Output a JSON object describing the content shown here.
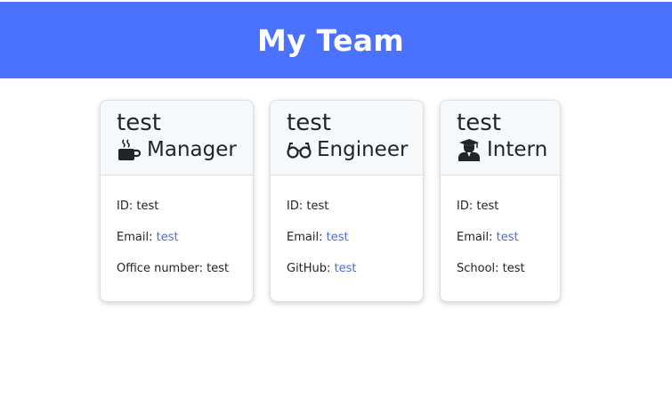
{
  "header": {
    "title": "My Team"
  },
  "colors": {
    "header_bg": "#4a72ff",
    "link": "#4a6cdb"
  },
  "cards": [
    {
      "name": "test",
      "role": "Manager",
      "icon": "mug-icon",
      "id_label": "ID: ",
      "id_value": "test",
      "email_label": "Email: ",
      "email_value": "test",
      "extra_label": "Office number: ",
      "extra_value": "test"
    },
    {
      "name": "test",
      "role": "Engineer",
      "icon": "glasses-icon",
      "id_label": "ID: ",
      "id_value": "test",
      "email_label": "Email: ",
      "email_value": "test",
      "extra_label": "GitHub: ",
      "extra_value": "test"
    },
    {
      "name": "test",
      "role": "Intern",
      "icon": "graduate-icon",
      "id_label": "ID: ",
      "id_value": "test",
      "email_label": "Email: ",
      "email_value": "test",
      "extra_label": "School: ",
      "extra_value": "test"
    }
  ]
}
